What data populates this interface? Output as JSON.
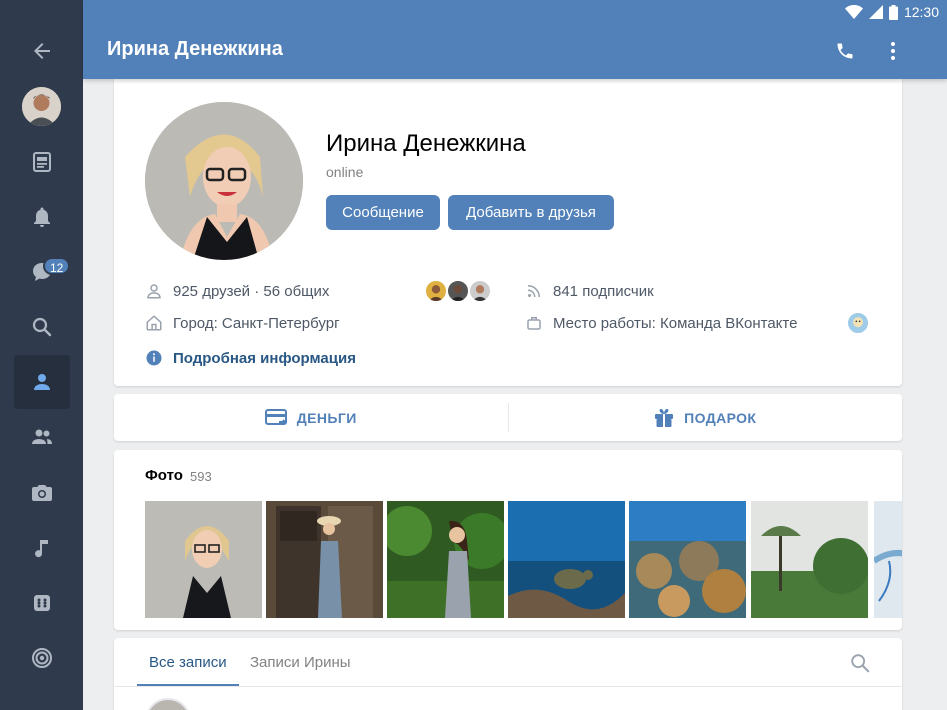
{
  "status_bar": {
    "time": "12:30"
  },
  "header": {
    "title": "Ирина Денежкина"
  },
  "sidebar": {
    "items": [
      {
        "icon": "back-arrow-icon"
      },
      {
        "icon": "user-avatar"
      },
      {
        "icon": "news-icon"
      },
      {
        "icon": "bell-icon"
      },
      {
        "icon": "messages-icon",
        "badge": "12"
      },
      {
        "icon": "search-icon"
      },
      {
        "icon": "profile-icon",
        "active": true
      },
      {
        "icon": "friends-icon"
      },
      {
        "icon": "camera-icon"
      },
      {
        "icon": "music-icon"
      },
      {
        "icon": "games-icon"
      },
      {
        "icon": "target-icon"
      }
    ]
  },
  "profile": {
    "name": "Ирина Денежкина",
    "status": "online",
    "message_button": "Сообщение",
    "add_friend_button": "Добавить в друзья",
    "friends": "925 друзей · 56 общих",
    "followers": "841 подписчик",
    "city": "Город: Санкт-Петербург",
    "work": "Место работы: Команда ВКонтакте",
    "more_info": "Подробная информация"
  },
  "actions": {
    "money": "ДЕНЬГИ",
    "gift": "ПОДАРОК"
  },
  "photos": {
    "title": "Фото",
    "count": "593"
  },
  "wall": {
    "tabs": [
      "Все записи",
      "Записи Ирины"
    ],
    "active_tab": 0
  },
  "colors": {
    "accent": "#5181b8",
    "sidebar": "#2f3b4d",
    "link": "#2a5885"
  }
}
